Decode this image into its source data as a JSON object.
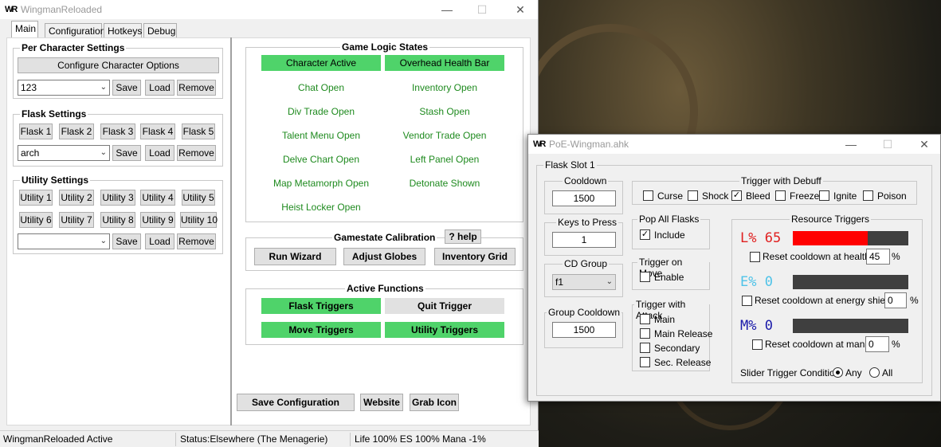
{
  "win1": {
    "title": "WingmanReloaded",
    "logo": "WR",
    "tabs": [
      "Main",
      "Configuration",
      "Hotkeys",
      "Debug"
    ],
    "per_char": {
      "title": "Per Character Settings",
      "configure_label": "Configure Character Options",
      "profile": "123",
      "save": "Save",
      "load": "Load",
      "remove": "Remove"
    },
    "flask": {
      "title": "Flask Settings",
      "buttons": [
        "Flask 1",
        "Flask 2",
        "Flask 3",
        "Flask 4",
        "Flask 5"
      ],
      "profile": "arch",
      "save": "Save",
      "load": "Load",
      "remove": "Remove"
    },
    "utility": {
      "title": "Utility Settings",
      "buttons": [
        "Utility 1",
        "Utility 2",
        "Utility 3",
        "Utility 4",
        "Utility 5",
        "Utility 6",
        "Utility 7",
        "Utility 8",
        "Utility 9",
        "Utility 10"
      ],
      "profile": "",
      "save": "Save",
      "load": "Load",
      "remove": "Remove"
    },
    "game_logic": {
      "title": "Game Logic States",
      "items": [
        "Character Active",
        "Overhead Health Bar",
        "Chat Open",
        "Inventory Open",
        "Div Trade Open",
        "Stash Open",
        "Talent Menu Open",
        "Vendor Trade Open",
        "Delve Chart Open",
        "Left Panel Open",
        "Map Metamorph Open",
        "Detonate Shown",
        "Heist Locker Open"
      ]
    },
    "calibration": {
      "title": "Gamestate Calibration",
      "help": "? help",
      "run_wizard": "Run Wizard",
      "adjust_globes": "Adjust Globes",
      "inventory_grid": "Inventory Grid"
    },
    "active": {
      "title": "Active Functions",
      "flask_triggers": "Flask Triggers",
      "quit_trigger": "Quit Trigger",
      "move_triggers": "Move Triggers",
      "utility_triggers": "Utility Triggers"
    },
    "bottom": {
      "save_config": "Save Configuration",
      "website": "Website",
      "grab_icon": "Grab Icon"
    },
    "status": {
      "left": "WingmanReloaded Active",
      "mid": "Status:Elsewhere (The Menagerie)",
      "right": "Life 100% ES 100% Mana -1%"
    }
  },
  "win2": {
    "title": "PoE-Wingman.ahk",
    "logo": "WR",
    "slot_title": "Flask Slot 1",
    "cooldown": {
      "label": "Cooldown",
      "value": "1500"
    },
    "keys": {
      "label": "Keys to Press",
      "value": "1"
    },
    "cd_group": {
      "label": "CD Group",
      "value": "f1"
    },
    "group_cooldown": {
      "label": "Group Cooldown",
      "value": "1500"
    },
    "debuff": {
      "title": "Trigger with Debuff",
      "items": [
        "Curse",
        "Shock",
        "Bleed",
        "Freeze",
        "Ignite",
        "Poison"
      ],
      "checked": [
        false,
        false,
        true,
        false,
        false,
        false
      ]
    },
    "pop_all": {
      "title": "Pop All Flasks",
      "include": "Include",
      "checked": true
    },
    "trigger_move": {
      "title": "Trigger on Move",
      "enable": "Enable",
      "checked": false
    },
    "trigger_attack": {
      "title": "Trigger with Attack",
      "items": [
        "Main",
        "Main Release",
        "Secondary",
        "Sec. Release"
      ]
    },
    "resource": {
      "title": "Resource Triggers",
      "life": {
        "label": "L% 65",
        "fill": 0.65,
        "color": "#ff0000",
        "reset_label": "Reset cooldown at health:",
        "value": "45"
      },
      "es": {
        "label": "E% 0",
        "fill": 0.0,
        "color": "#4fc3e8",
        "reset_label": "Reset cooldown at energy shield:",
        "value": "0"
      },
      "mana": {
        "label": "M% 0",
        "fill": 0.0,
        "color": "#1a1aaa",
        "reset_label": "Reset cooldown at mana:",
        "value": "0"
      },
      "percent": "%",
      "slider_label": "Slider Trigger Condition:",
      "any": "Any",
      "all": "All"
    }
  }
}
